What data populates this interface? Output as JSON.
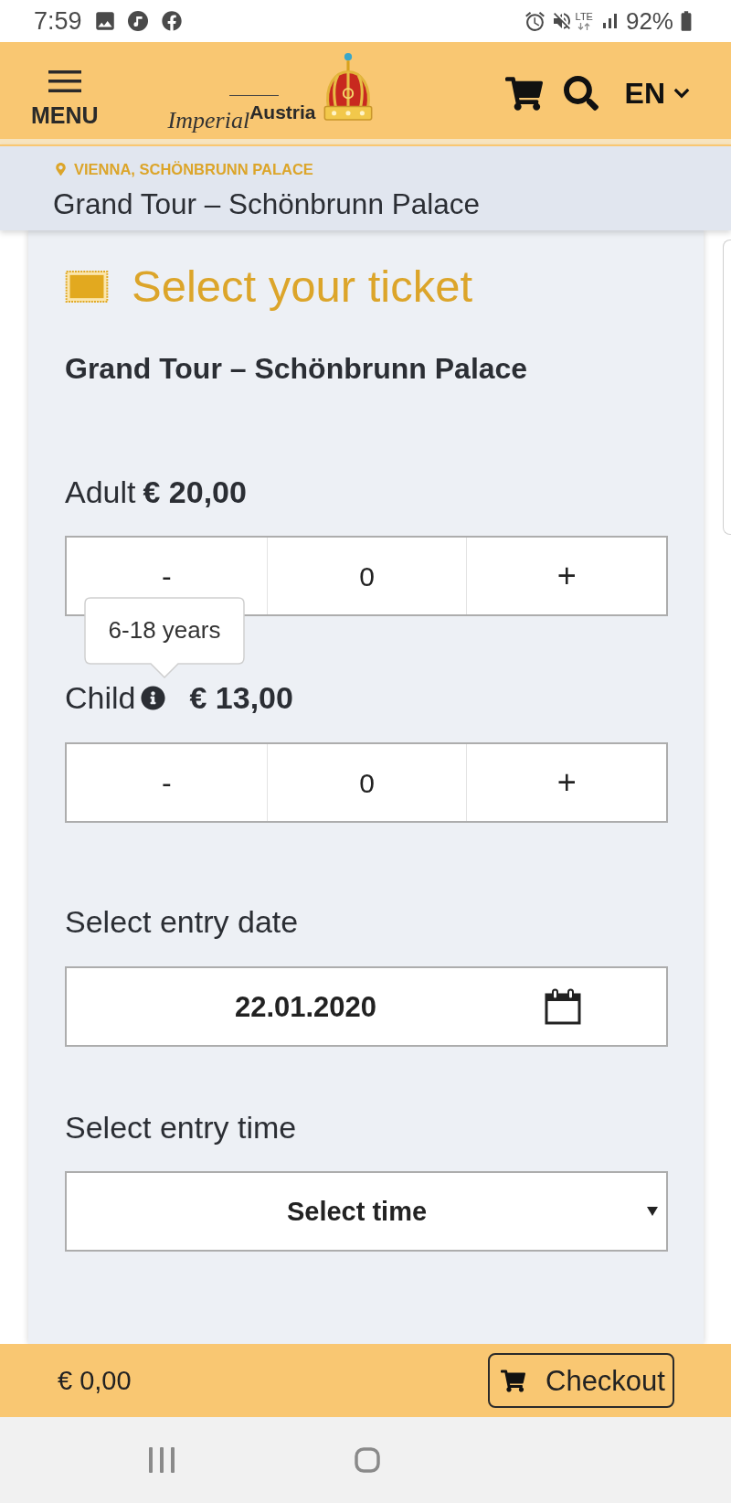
{
  "status_bar": {
    "time": "7:59",
    "network_type": "LTE",
    "battery": "92%"
  },
  "header": {
    "menu_label": "MENU",
    "logo": {
      "script": "Imperial",
      "word": "Austria"
    },
    "language": "EN"
  },
  "breadcrumb": {
    "location": "VIENNA, SCHÖNBRUNN PALACE",
    "title": "Grand Tour – Schönbrunn Palace"
  },
  "ticket_panel": {
    "heading": "Select your ticket",
    "tour_name": "Grand Tour – Schönbrunn Palace",
    "tickets": [
      {
        "label": "Adult",
        "price": "€ 20,00",
        "decrement": "-",
        "quantity": "0",
        "increment": "+"
      },
      {
        "label": "Child",
        "tooltip": "6-18 years",
        "price": "€ 13,00",
        "decrement": "-",
        "quantity": "0",
        "increment": "+"
      }
    ],
    "date": {
      "label": "Select entry date",
      "value": "22.01.2020"
    },
    "time": {
      "label": "Select entry time",
      "placeholder": "Select time"
    }
  },
  "footer": {
    "total": "€ 0,00",
    "checkout": "Checkout"
  }
}
